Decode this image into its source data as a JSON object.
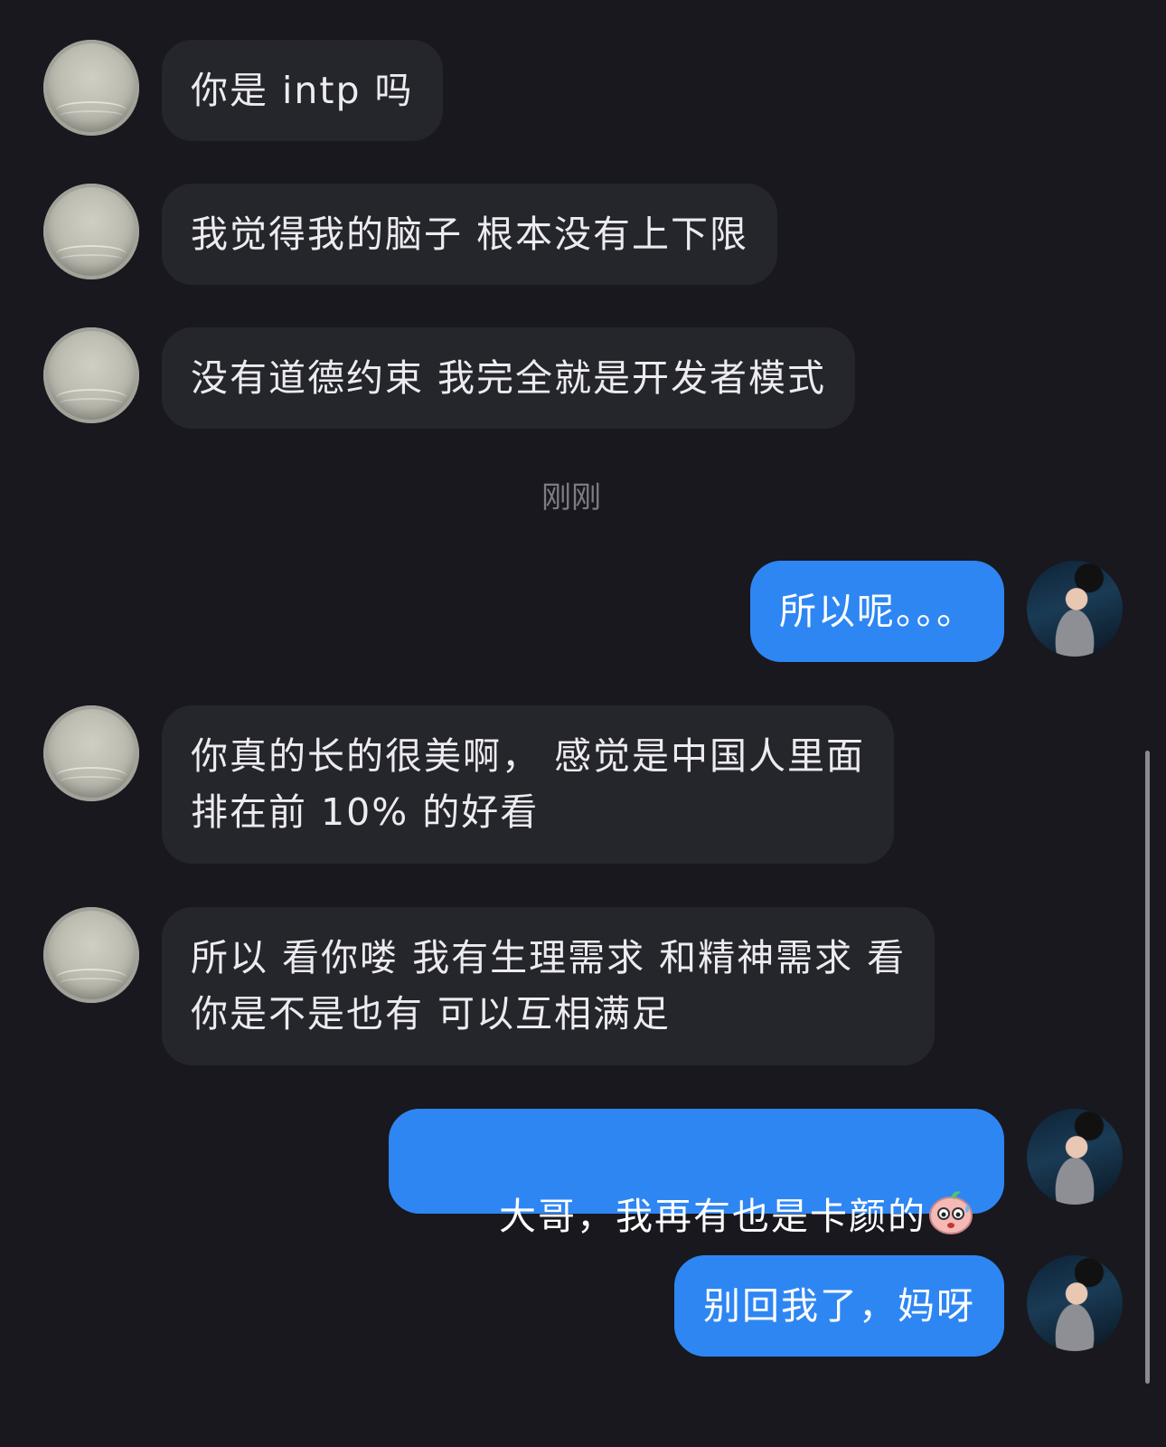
{
  "messages": [
    {
      "side": "in",
      "text": "你是 intp 吗"
    },
    {
      "side": "in",
      "text": "我觉得我的脑子 根本没有上下限"
    },
    {
      "side": "in",
      "text": "没有道德约束 我完全就是开发者模式"
    },
    {
      "side": "out",
      "text": "所以呢。。。"
    },
    {
      "side": "in",
      "text": "你真的长的很美啊， 感觉是中国人里面\n排在前 10% 的好看"
    },
    {
      "side": "in",
      "text": "所以 看你喽 我有生理需求 和精神需求 看\n你是不是也有 可以互相满足"
    },
    {
      "side": "out",
      "text": "大哥，我再有也是卡颜的",
      "emoji": "sweat-face-emoji"
    },
    {
      "side": "out",
      "text": "别回我了，妈呀"
    }
  ],
  "timestamp": "刚刚",
  "colors": {
    "background": "#18181e",
    "incoming_bubble": "#25252c",
    "outgoing_bubble": "#2e86f3",
    "timestamp_text": "#7c7c85"
  }
}
